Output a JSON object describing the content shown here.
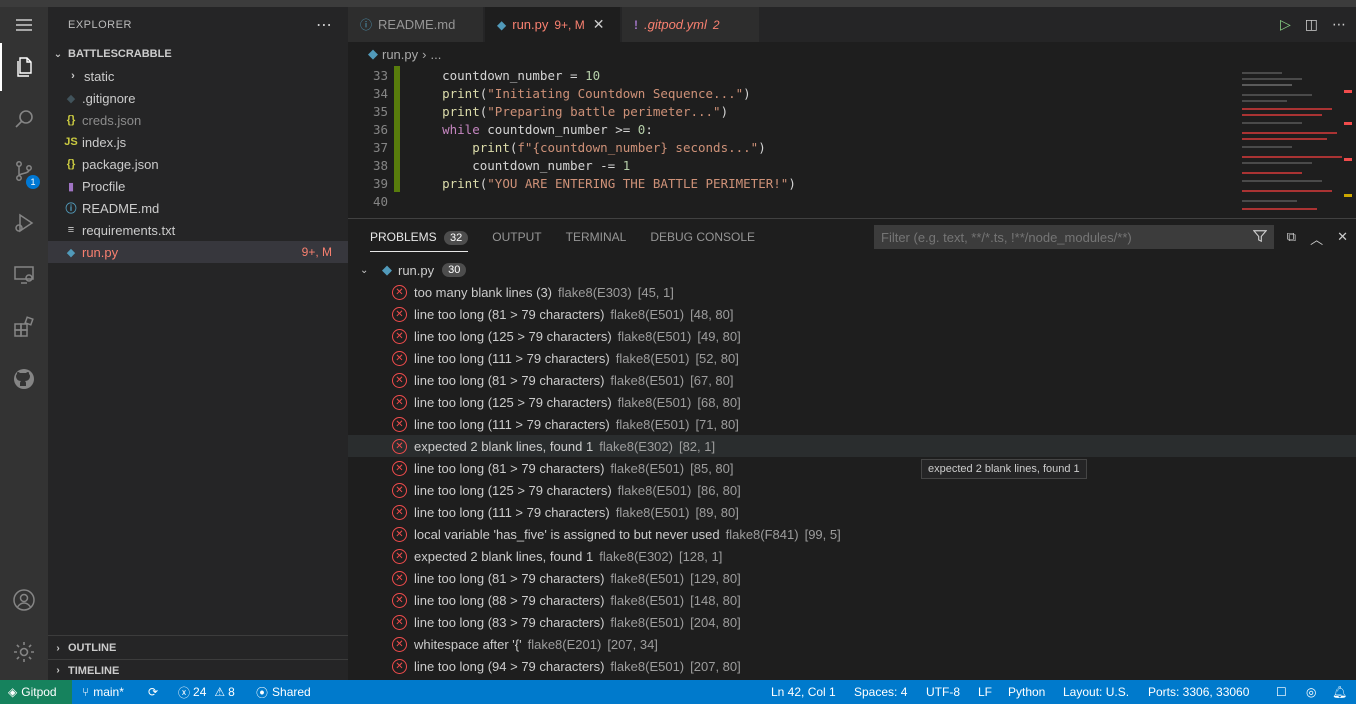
{
  "sidebar": {
    "title": "EXPLORER",
    "folder": "BATTLESCRABBLE",
    "items": [
      {
        "icon": "›",
        "label": "static",
        "status": "",
        "color": "#cccccc",
        "iconColor": "#cccccc"
      },
      {
        "icon": "◆",
        "label": ".gitignore",
        "status": "",
        "color": "#cccccc",
        "iconColor": "#41535b"
      },
      {
        "icon": "{}",
        "label": "creds.json",
        "status": "",
        "color": "#8c8c8c",
        "iconColor": "#cbcb41"
      },
      {
        "icon": "JS",
        "label": "index.js",
        "status": "",
        "color": "#cccccc",
        "iconColor": "#cbcb41"
      },
      {
        "icon": "{}",
        "label": "package.json",
        "status": "",
        "color": "#cccccc",
        "iconColor": "#cbcb41"
      },
      {
        "icon": "▮",
        "label": "Procfile",
        "status": "",
        "color": "#cccccc",
        "iconColor": "#a074c4"
      },
      {
        "icon": "ⓘ",
        "label": "README.md",
        "status": "",
        "color": "#cccccc",
        "iconColor": "#519aba"
      },
      {
        "icon": "≡",
        "label": "requirements.txt",
        "status": "",
        "color": "#cccccc",
        "iconColor": "#cccccc"
      },
      {
        "icon": "◆",
        "label": "run.py",
        "status": "9+, M",
        "color": "#f88070",
        "iconColor": "#519aba"
      }
    ],
    "outline": "OUTLINE",
    "timeline": "TIMELINE"
  },
  "tabs": [
    {
      "icon": "ⓘ",
      "label": "README.md",
      "badge": "",
      "color": "#969696"
    },
    {
      "icon": "◆",
      "label": "run.py",
      "badge": "9+, M",
      "color": "#f88070"
    },
    {
      "icon": "!",
      "label": ".gitpod.yml",
      "badge": "2",
      "color": "#f88070"
    }
  ],
  "breadcrumb": {
    "file": "run.py",
    "rest": "..."
  },
  "code": [
    {
      "n": "33",
      "t": "    countdown_number = 10"
    },
    {
      "n": "34",
      "t": "    print(\"Initiating Countdown Sequence...\")"
    },
    {
      "n": "35",
      "t": "    print(\"Preparing battle perimeter...\")"
    },
    {
      "n": "36",
      "t": "    while countdown_number >= 0:"
    },
    {
      "n": "37",
      "t": "        print(f\"{countdown_number} seconds...\")"
    },
    {
      "n": "38",
      "t": "        countdown_number -= 1"
    },
    {
      "n": "39",
      "t": "    print(\"YOU ARE ENTERING THE BATTLE PERIMETER!\")"
    },
    {
      "n": "40",
      "t": ""
    }
  ],
  "panel": {
    "tabs": [
      "PROBLEMS",
      "OUTPUT",
      "TERMINAL",
      "DEBUG CONSOLE"
    ],
    "problems_count": "32",
    "filter_placeholder": "Filter (e.g. text, **/*.ts, !**/node_modules/**)",
    "file": "run.py",
    "file_count": "30",
    "problems": [
      {
        "msg": "too many blank lines (3)",
        "src": "flake8(E303)",
        "pos": "[45, 1]"
      },
      {
        "msg": "line too long (81 > 79 characters)",
        "src": "flake8(E501)",
        "pos": "[48, 80]"
      },
      {
        "msg": "line too long (125 > 79 characters)",
        "src": "flake8(E501)",
        "pos": "[49, 80]"
      },
      {
        "msg": "line too long (111 > 79 characters)",
        "src": "flake8(E501)",
        "pos": "[52, 80]"
      },
      {
        "msg": "line too long (81 > 79 characters)",
        "src": "flake8(E501)",
        "pos": "[67, 80]"
      },
      {
        "msg": "line too long (125 > 79 characters)",
        "src": "flake8(E501)",
        "pos": "[68, 80]"
      },
      {
        "msg": "line too long (111 > 79 characters)",
        "src": "flake8(E501)",
        "pos": "[71, 80]"
      },
      {
        "msg": "expected 2 blank lines, found 1",
        "src": "flake8(E302)",
        "pos": "[82, 1]"
      },
      {
        "msg": "line too long (81 > 79 characters)",
        "src": "flake8(E501)",
        "pos": "[85, 80]"
      },
      {
        "msg": "line too long (125 > 79 characters)",
        "src": "flake8(E501)",
        "pos": "[86, 80]"
      },
      {
        "msg": "line too long (111 > 79 characters)",
        "src": "flake8(E501)",
        "pos": "[89, 80]"
      },
      {
        "msg": "local variable 'has_five' is assigned to but never used",
        "src": "flake8(F841)",
        "pos": "[99, 5]"
      },
      {
        "msg": "expected 2 blank lines, found 1",
        "src": "flake8(E302)",
        "pos": "[128, 1]"
      },
      {
        "msg": "line too long (81 > 79 characters)",
        "src": "flake8(E501)",
        "pos": "[129, 80]"
      },
      {
        "msg": "line too long (88 > 79 characters)",
        "src": "flake8(E501)",
        "pos": "[148, 80]"
      },
      {
        "msg": "line too long (83 > 79 characters)",
        "src": "flake8(E501)",
        "pos": "[204, 80]"
      },
      {
        "msg": "whitespace after '{'",
        "src": "flake8(E201)",
        "pos": "[207, 34]"
      },
      {
        "msg": "line too long (94 > 79 characters)",
        "src": "flake8(E501)",
        "pos": "[207, 80]"
      }
    ],
    "tooltip": "expected 2 blank lines, found 1"
  },
  "statusbar": {
    "remote": "Gitpod",
    "branch": "main*",
    "errors": "24",
    "warnings": "8",
    "shared": "Shared",
    "position": "Ln 42, Col 1",
    "spaces": "Spaces: 4",
    "encoding": "UTF-8",
    "eol": "LF",
    "language": "Python",
    "layout": "Layout: U.S.",
    "ports": "Ports: 3306, 33060"
  },
  "source_control_badge": "1",
  "colors": {
    "accent": "#007acc",
    "remote": "#16825d",
    "error": "#f14c4c",
    "modified": "#e2c08d"
  }
}
